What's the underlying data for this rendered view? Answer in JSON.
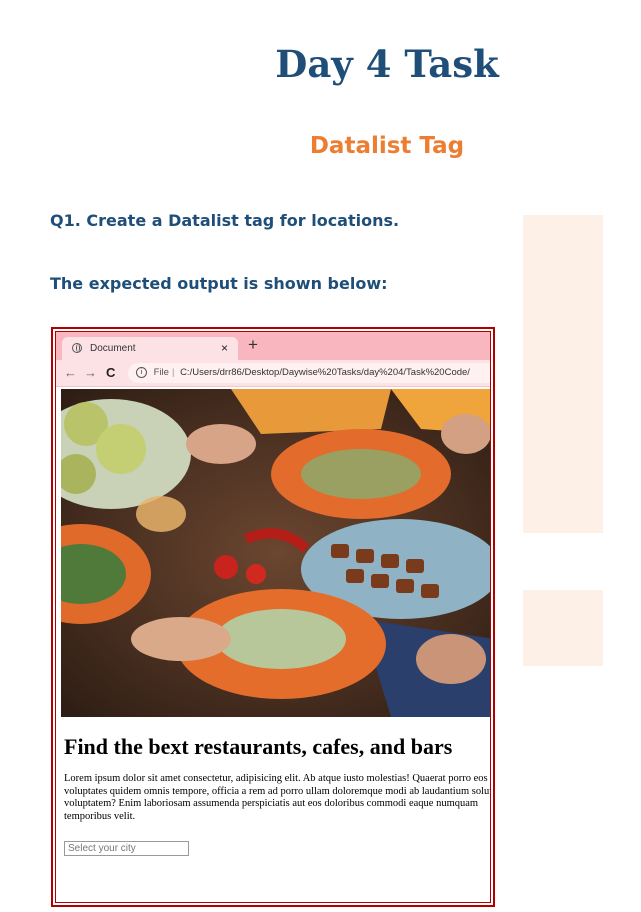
{
  "title": "Day 4 Task",
  "subtitle": "Datalist Tag",
  "question": "Q1. Create a Datalist tag for locations.",
  "expected_label": "The expected output is shown below:",
  "browser": {
    "tab_title": "Document",
    "tab_close": "×",
    "new_tab": "+",
    "url_scheme": "File",
    "url": "C:/Users/drr86/Desktop/Daywise%20Tasks/day%204/Task%20Code/"
  },
  "page": {
    "heading": "Find the bext restaurants, cafes, and bars",
    "body": "Lorem ipsum dolor sit amet consectetur, adipisicing elit. Ab atque iusto molestias! Quaerat porro eos voluptates quidem omnis tempore, officia a rem ad porro ullam doloremque modi ab laudantium soluta ea voluptatem? Enim laboriosam assumenda perspiciatis aut eos doloribus commodi eaque numquam temporibus velit.",
    "input_placeholder": "Select your city"
  },
  "colors": {
    "title": "#1f4e79",
    "subtitle": "#ed7d31",
    "frame_border": "#b00000",
    "tab_strip": "#f9b6bf"
  }
}
